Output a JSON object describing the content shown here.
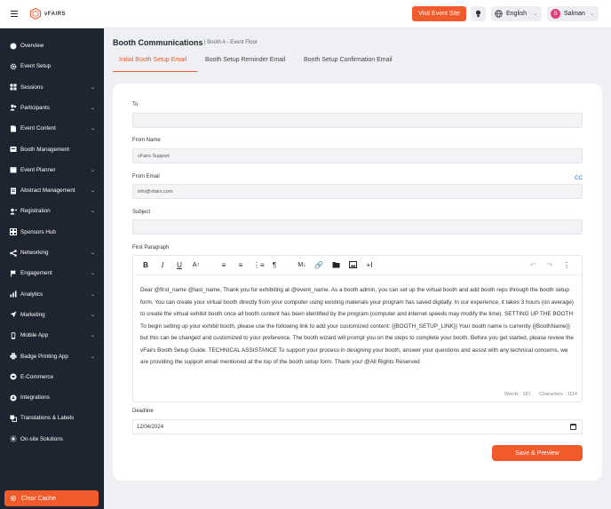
{
  "header": {
    "logo_text": "vFAIRS",
    "visit_button": "Visit Event Site",
    "language": "English",
    "user_initial": "S",
    "user_name": "Salman"
  },
  "sidebar": {
    "items": [
      {
        "label": "Overview",
        "icon": "overview-icon",
        "has_caret": false
      },
      {
        "label": "Event Setup",
        "icon": "gear-icon",
        "has_caret": false
      },
      {
        "label": "Sessions",
        "icon": "grid-icon",
        "has_caret": true
      },
      {
        "label": "Participants",
        "icon": "users-icon",
        "has_caret": true
      },
      {
        "label": "Event Content",
        "icon": "document-icon",
        "has_caret": true
      },
      {
        "label": "Booth Management",
        "icon": "booth-icon",
        "has_caret": false
      },
      {
        "label": "Event Planner",
        "icon": "planner-icon",
        "has_caret": true
      },
      {
        "label": "Abstract Management",
        "icon": "abstract-icon",
        "has_caret": true
      },
      {
        "label": "Registration",
        "icon": "registration-icon",
        "has_caret": true
      },
      {
        "label": "Sponsors Hub",
        "icon": "sponsors-icon",
        "has_caret": false
      },
      {
        "label": "Networking",
        "icon": "share-icon",
        "has_caret": true
      },
      {
        "label": "Engagement",
        "icon": "flag-icon",
        "has_caret": true
      },
      {
        "label": "Analytics",
        "icon": "bar-chart-icon",
        "has_caret": true
      },
      {
        "label": "Marketing",
        "icon": "send-icon",
        "has_caret": true
      },
      {
        "label": "Mobile App",
        "icon": "mobile-icon",
        "has_caret": true
      },
      {
        "label": "Badge Printing App",
        "icon": "printer-icon",
        "has_caret": true
      },
      {
        "label": "E-Commerce",
        "icon": "cart-icon",
        "has_caret": false
      },
      {
        "label": "Integrations",
        "icon": "plug-icon",
        "has_caret": false
      },
      {
        "label": "Translations & Labels",
        "icon": "translate-icon",
        "has_caret": false
      },
      {
        "label": "On-site Solutions",
        "icon": "onsite-icon",
        "has_caret": false
      }
    ],
    "clear_cache": "Clear Cache"
  },
  "main": {
    "title": "Booth Communications",
    "breadcrumb": "|  Booth A - Event Floor",
    "tabs": [
      {
        "label": "Initial Booth Setup Email",
        "active": true
      },
      {
        "label": "Booth Setup Reminder Email",
        "active": false
      },
      {
        "label": "Booth Setup Confirmation Email",
        "active": false
      }
    ],
    "form": {
      "to_label": "To",
      "to_value": "",
      "from_name_label": "From Name",
      "from_name_value": "vFairs Support",
      "from_email_label": "From Email",
      "from_email_value": "info@vfairs.com",
      "cc_link": "CC",
      "subject_label": "Subject",
      "subject_value": "",
      "first_paragraph_label": "First Paragraph",
      "body": "Dear @first_name @last_name, Thank you for exhibiting at @event_name. As a booth admin, you can set up the virtual booth and add booth reps through the booth setup form. You can create your virtual booth directly from your computer using existing materials your program has saved digitally. In our experience, it takes 3 hours (on average) to create the virtual exhibit booth once all booth content has been identified by the program (computer and internet speeds may modify the time). SETTING UP THE BOOTH To begin setting up your exhibit booth, please use the following link to add your customized content: {{BOOTH_SETUP_LINK}} Your booth name is currently {{BoothName}} but this can be changed and customized to your preference. The booth wizard will prompt you on the steps to complete your booth. Before you get started, please review the vFairs Booth Setup Guide. TECHNICAL ASSISTANCE To support your process in designing your booth, answer your questions and assist with any technical concerns, we are providing the support email mentioned at the top of the booth setup form. Thank you! @All Rights Reserved",
      "words": "Words : 181",
      "characters": "Characters : 1114",
      "deadline_label": "Deadline",
      "deadline_value": "12/04/2024",
      "save_button": "Save & Preview"
    }
  },
  "colors": {
    "accent": "#f15a2b",
    "sidebar_bg": "#1e2430",
    "link": "#2b6fd6"
  }
}
